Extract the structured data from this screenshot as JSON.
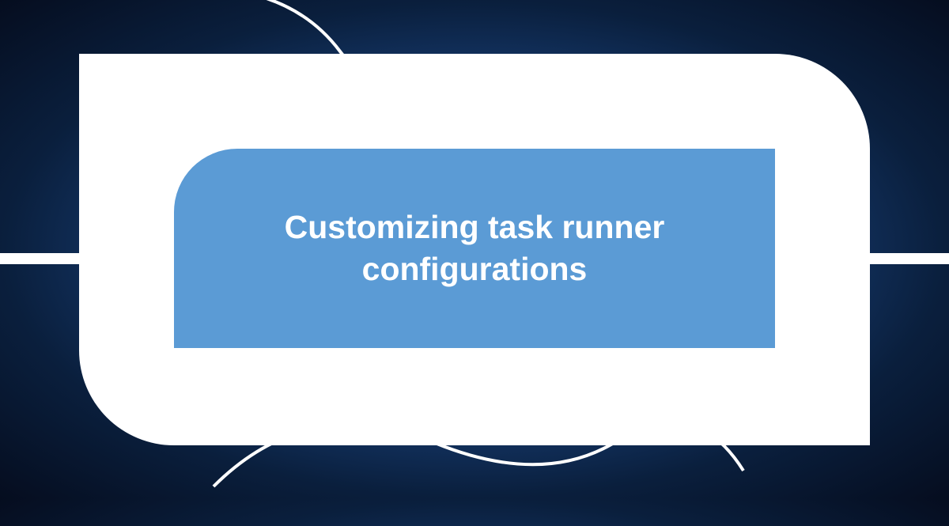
{
  "title": "Customizing task runner configurations",
  "colors": {
    "accent": "#5b9bd5",
    "frame": "#ffffff",
    "bgDark": "#0a1f3d",
    "bgLight": "#3d7bc4"
  }
}
